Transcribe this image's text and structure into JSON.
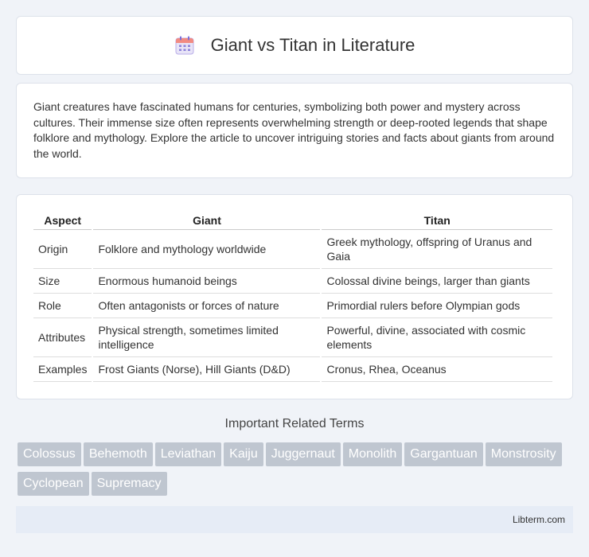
{
  "header": {
    "title": "Giant vs Titan in Literature",
    "icon": "calendar-icon"
  },
  "intro": {
    "text": "Giant creatures have fascinated humans for centuries, symbolizing both power and mystery across cultures. Their immense size often represents overwhelming strength or deep-rooted legends that shape folklore and mythology. Explore the article to uncover intriguing stories and facts about giants from around the world."
  },
  "table": {
    "headers": [
      "Aspect",
      "Giant",
      "Titan"
    ],
    "rows": [
      [
        "Origin",
        "Folklore and mythology worldwide",
        "Greek mythology, offspring of Uranus and Gaia"
      ],
      [
        "Size",
        "Enormous humanoid beings",
        "Colossal divine beings, larger than giants"
      ],
      [
        "Role",
        "Often antagonists or forces of nature",
        "Primordial rulers before Olympian gods"
      ],
      [
        "Attributes",
        "Physical strength, sometimes limited intelligence",
        "Powerful, divine, associated with cosmic elements"
      ],
      [
        "Examples",
        "Frost Giants (Norse), Hill Giants (D&D)",
        "Cronus, Rhea, Oceanus"
      ]
    ]
  },
  "related": {
    "title": "Important Related Terms",
    "tags": [
      "Colossus",
      "Behemoth",
      "Leviathan",
      "Kaiju",
      "Juggernaut",
      "Monolith",
      "Gargantuan",
      "Monstrosity",
      "Cyclopean",
      "Supremacy"
    ]
  },
  "footer": {
    "text": "Libterm.com"
  }
}
